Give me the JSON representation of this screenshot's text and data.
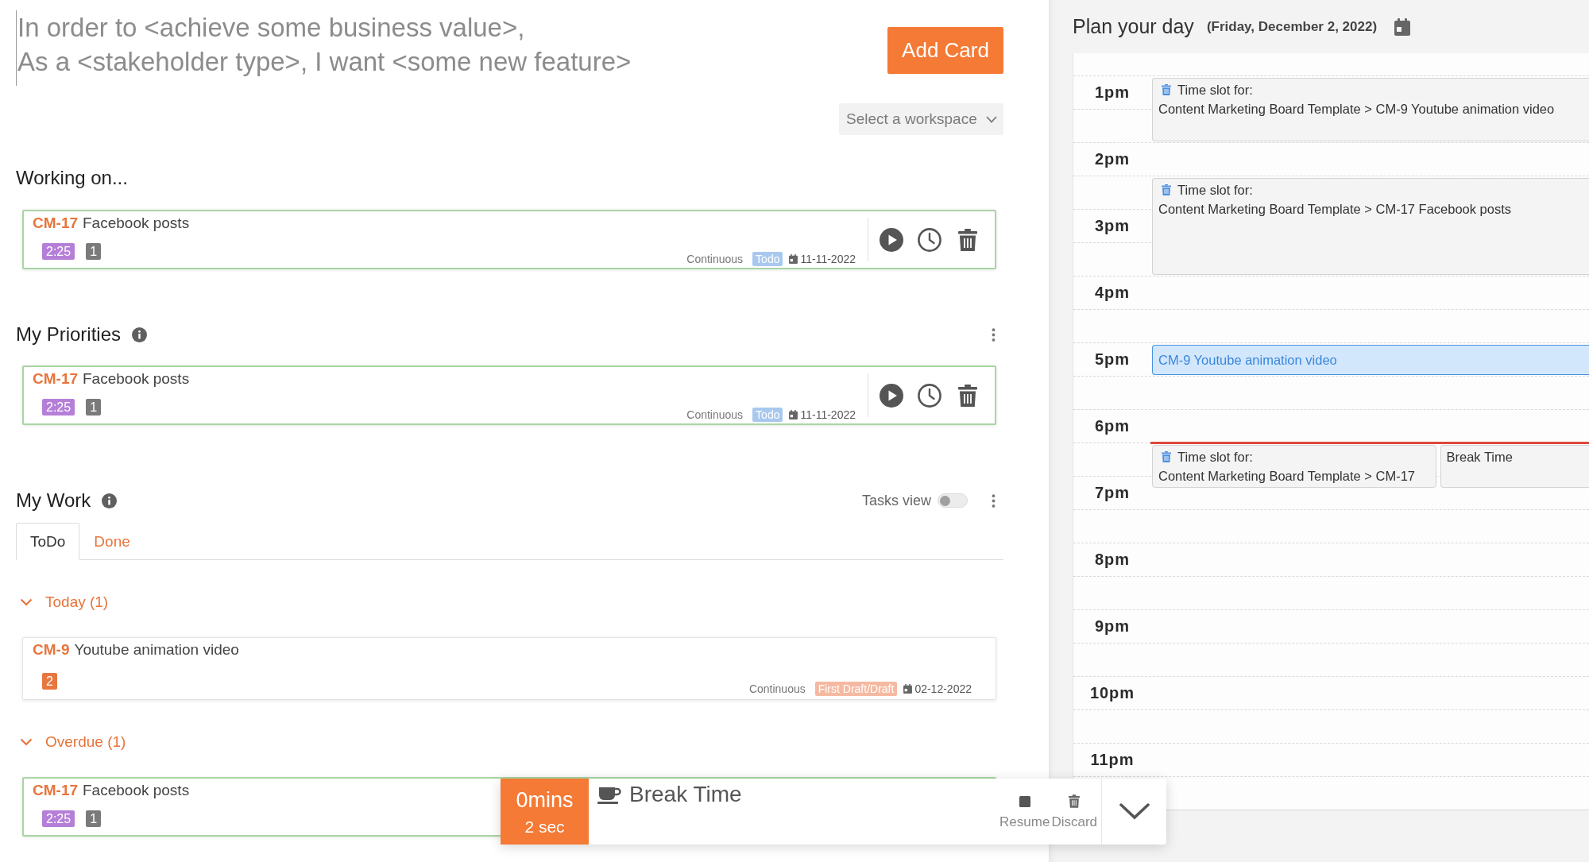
{
  "story_input": {
    "placeholder": "In order to <achieve some business value>,\nAs a <stakeholder type>, I want <some new feature>"
  },
  "add_card_button": {
    "label": "Add Card"
  },
  "workspace_select": {
    "label": "Select a workspace"
  },
  "working_on": {
    "title": "Working on...",
    "cards": [
      {
        "key": "CM-17",
        "title": "Facebook posts",
        "highlighted": true,
        "badges": [
          {
            "text": "2:25",
            "color": "#b57fd8"
          },
          {
            "text": "1",
            "color": "#7a7a7a"
          }
        ],
        "type": "Continuous",
        "status": {
          "text": "Todo",
          "color": "#a8c8ee"
        },
        "date": "11-11-2022",
        "has_actions": true
      }
    ]
  },
  "priorities": {
    "title": "My Priorities",
    "cards": [
      {
        "key": "CM-17",
        "title": "Facebook posts",
        "highlighted": true,
        "badges": [
          {
            "text": "2:25",
            "color": "#b57fd8"
          },
          {
            "text": "1",
            "color": "#7a7a7a"
          }
        ],
        "type": "Continuous",
        "status": {
          "text": "Todo",
          "color": "#a8c8ee"
        },
        "date": "11-11-2022",
        "has_actions": true
      }
    ]
  },
  "my_work": {
    "title": "My Work",
    "tasks_view": {
      "label": "Tasks view",
      "on": false
    },
    "tabs": [
      {
        "label": "ToDo",
        "selected": true
      },
      {
        "label": "Done",
        "selected": false
      }
    ],
    "groups": [
      {
        "title": "Today (1)",
        "expanded": true,
        "cards": [
          {
            "key": "CM-9",
            "title": "Youtube animation video",
            "highlighted": false,
            "badges": [
              {
                "text": "2",
                "color": "#e8773f"
              }
            ],
            "type": "Continuous",
            "status": {
              "text": "First Draft/Draft",
              "color": "#f5b9a1"
            },
            "date": "02-12-2022",
            "has_actions": false
          }
        ]
      },
      {
        "title": "Overdue (1)",
        "expanded": true,
        "cards": [
          {
            "key": "CM-17",
            "title": "Facebook posts",
            "highlighted": true,
            "badges": [
              {
                "text": "2:25",
                "color": "#b57fd8"
              },
              {
                "text": "1",
                "color": "#7a7a7a"
              }
            ]
          }
        ]
      }
    ]
  },
  "timer": {
    "minutes": "0mins",
    "seconds": "2 sec",
    "title": "Break Time",
    "actions": [
      {
        "kind": "stop",
        "label": "Resume"
      },
      {
        "kind": "discard",
        "label": "Discard"
      }
    ]
  },
  "planner": {
    "title": "Plan your day",
    "date": "(Friday, December 2, 2022)",
    "slots": [
      {
        "hour": "1pm",
        "now": false,
        "continued": false,
        "events": [
          {
            "kind": "slot",
            "label": "Time slot for:",
            "text": "Content Marketing Board Template > CM-9 Youtube animation video"
          }
        ]
      },
      {
        "now": false,
        "continued": true
      },
      {
        "hour": "2pm",
        "now": false,
        "continued": false
      },
      {
        "now": false,
        "continued": false,
        "events": [
          {
            "kind": "slot",
            "label": "Time slot for:",
            "text": "Content Marketing Board Template > CM-17 Facebook posts"
          }
        ]
      },
      {
        "hour": "3pm",
        "now": false,
        "continued": true
      },
      {
        "now": false,
        "continued": true
      },
      {
        "hour": "4pm",
        "now": false,
        "continued": false
      },
      {
        "now": false,
        "continued": false
      },
      {
        "hour": "5pm",
        "now": false,
        "continued": false,
        "events": [
          {
            "kind": "task",
            "text": "CM-9 Youtube animation video"
          }
        ]
      },
      {
        "now": false,
        "continued": false
      },
      {
        "hour": "6pm",
        "now": false,
        "continued": false
      },
      {
        "now": true,
        "continued": false,
        "events": [
          {
            "kind": "slot",
            "label": "Time slot for:",
            "text": "Content Marketing Board Template > CM-17"
          },
          {
            "kind": "break",
            "text": "Break Time"
          }
        ]
      },
      {
        "hour": "7pm",
        "now": false,
        "continued": false
      },
      {
        "now": false,
        "continued": false
      },
      {
        "hour": "8pm",
        "now": false,
        "continued": false
      },
      {
        "now": false,
        "continued": false
      },
      {
        "hour": "9pm",
        "now": false,
        "continued": false
      },
      {
        "now": false,
        "continued": false
      },
      {
        "hour": "10pm",
        "now": false,
        "continued": false
      },
      {
        "now": false,
        "continued": false
      },
      {
        "hour": "11pm",
        "now": false,
        "continued": false
      },
      {
        "now": false,
        "continued": false
      }
    ]
  }
}
